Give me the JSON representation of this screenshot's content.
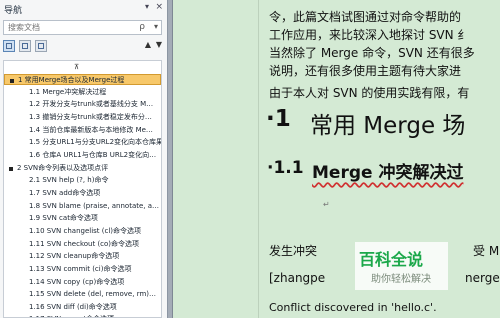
{
  "nav": {
    "title": "导航",
    "close_glyph": "×",
    "dropdown_glyph": "▾",
    "search_placeholder": "搜索文档",
    "search_glyph": "ρ",
    "search_dd_glyph": "▾",
    "up_glyph": "▲",
    "down_glyph": "▼",
    "collapse_glyph": "⊼",
    "tree": [
      {
        "label": "1 常用Merge场合以及Merge过程",
        "level": 1,
        "selected": true
      },
      {
        "label": "1.1 Merge冲突解决过程",
        "level": 2
      },
      {
        "label": "1.2 开发分支与trunk或者基线分支 M…",
        "level": 2
      },
      {
        "label": "1.3 撤销分支与trunk或者稳定发布分…",
        "level": 2
      },
      {
        "label": "1.4 当前仓库最新版本与本地修改 Me…",
        "level": 2
      },
      {
        "label": "1.5 分支URL1与分支URL2变化向本仓库果…",
        "level": 2
      },
      {
        "label": "1.6 仓库A URL1与仓库B URL2变化向…",
        "level": 2
      },
      {
        "label": "2 SVN命令列表以及选项点评",
        "level": 1
      },
      {
        "label": "2.1 SVN help (?, h)命令",
        "level": 2
      },
      {
        "label": "1.7 SVN add命令选项",
        "level": 2
      },
      {
        "label": "1.8 SVN blame (praise, annotate, a…",
        "level": 2
      },
      {
        "label": "1.9 SVN cat命令选项",
        "level": 2
      },
      {
        "label": "1.10 SVN changelist (cl)命令选项",
        "level": 2
      },
      {
        "label": "1.11 SVN checkout (co)命令选项",
        "level": 2
      },
      {
        "label": "1.12 SVN cleanup命令选项",
        "level": 2
      },
      {
        "label": "1.13 SVN commit (ci)命令选项",
        "level": 2
      },
      {
        "label": "1.14 SVN copy (cp)命令选项",
        "level": 2
      },
      {
        "label": "1.15 SVN delete (del, remove, rm)…",
        "level": 2
      },
      {
        "label": "1.16 SVN diff (di)命令选项",
        "level": 2
      },
      {
        "label": "1.17 SVN export命令选项",
        "level": 2
      }
    ]
  },
  "doc": {
    "para1_line1": "令，此篇文档试图通过对命令帮助的",
    "para1_line2": "工作应用，来比较深入地探讨 SVN 纟",
    "para1_line3": "当然除了 Merge 命令，SVN 还有很多",
    "para1_line4": "说明，还有很多使用主题有待大家进",
    "para2": "由于本人对 SVN 的使用实践有限，有",
    "h1_number": "·1",
    "h1_text": "常用 Merge 场",
    "h2_number": "·1.1",
    "h2_text": "Merge 冲突解决过",
    "return_mark": "↵",
    "para3": "发生冲突",
    "para3_tail": "受 M",
    "para4": "[zhangpe",
    "para4_tail": "nerge",
    "para5": "Conflict discovered in 'hello.c'."
  },
  "watermark": {
    "logo": "百科全说",
    "sub": "助你轻松解决"
  }
}
